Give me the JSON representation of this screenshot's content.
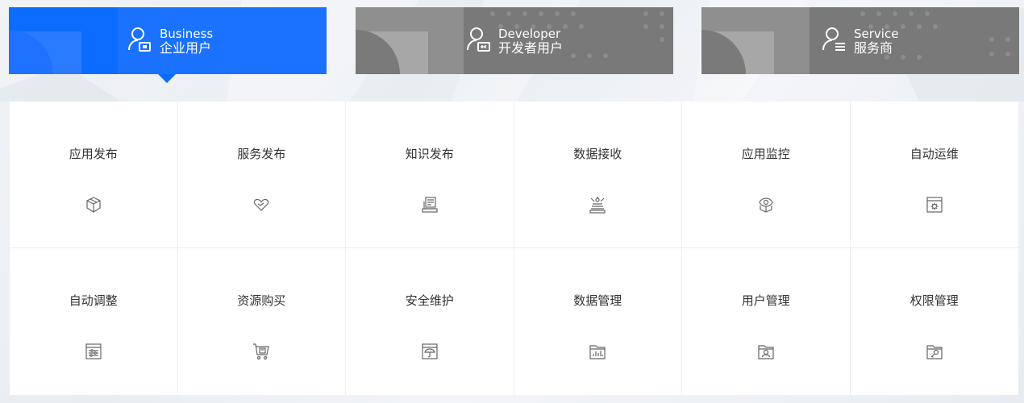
{
  "tabs": [
    {
      "en": "Business",
      "zh": "企业用户",
      "icon": "business-user-icon",
      "active": true
    },
    {
      "en": "Developer",
      "zh": "开发者用户",
      "icon": "developer-user-icon",
      "active": false
    },
    {
      "en": "Service",
      "zh": "服务商",
      "icon": "service-provider-icon",
      "active": false
    }
  ],
  "colors": {
    "active_tab": "#0b6cff",
    "inactive_tab": "#8f8f8f",
    "text": "#333333",
    "icon": "#666666"
  },
  "features": [
    {
      "label": "应用发布",
      "icon": "cube-icon"
    },
    {
      "label": "服务发布",
      "icon": "heart-hand-icon"
    },
    {
      "label": "知识发布",
      "icon": "document-stack-icon"
    },
    {
      "label": "数据接收",
      "icon": "data-receive-icon"
    },
    {
      "label": "应用监控",
      "icon": "eye-monitor-icon"
    },
    {
      "label": "自动运维",
      "icon": "gear-window-icon"
    },
    {
      "label": "自动调整",
      "icon": "sliders-window-icon"
    },
    {
      "label": "资源购买",
      "icon": "shopping-cart-icon"
    },
    {
      "label": "安全维护",
      "icon": "umbrella-window-icon"
    },
    {
      "label": "数据管理",
      "icon": "bar-chart-folder-icon"
    },
    {
      "label": "用户管理",
      "icon": "user-folder-icon"
    },
    {
      "label": "权限管理",
      "icon": "key-folder-icon"
    }
  ]
}
